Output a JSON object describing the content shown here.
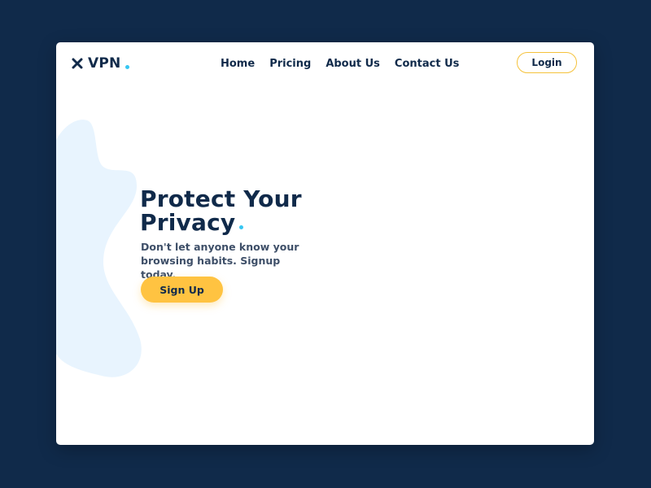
{
  "brand": {
    "name": "VPN",
    "icon": "x-icon",
    "accent_dot": "#37c6f2"
  },
  "nav": {
    "items": [
      {
        "label": "Home"
      },
      {
        "label": "Pricing"
      },
      {
        "label": "About Us"
      },
      {
        "label": "Contact Us"
      }
    ]
  },
  "header": {
    "login_label": "Login"
  },
  "hero": {
    "title_line1": "Protect Your",
    "title_line2": "Privacy",
    "subtitle": "Don't let anyone know your browsing habits. Signup today.",
    "signup_label": "Sign Up"
  },
  "colors": {
    "background": "#102a4a",
    "card": "#ffffff",
    "text": "#102a4a",
    "accent_yellow": "#ffc341",
    "accent_blue": "#37c6f2",
    "blob": "#e8f4fe"
  }
}
